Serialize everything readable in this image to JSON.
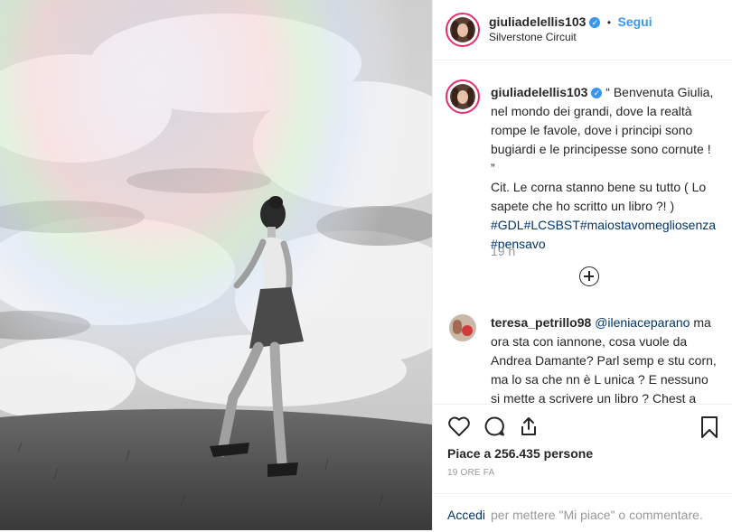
{
  "post": {
    "username": "giuliadelellis103",
    "verified_mark": "✓",
    "separator": "•",
    "follow_label": "Segui",
    "location": "Silverstone Circuit"
  },
  "caption": {
    "username": "giuliadelellis103",
    "line1": "“ Benvenuta Giulia,",
    "line2": "nel mondo dei grandi, dove la realtà",
    "line3": "rompe le favole, dove i principi sono",
    "line4": "bugiardi e le principesse sono cornute !",
    "line5": "”",
    "line6": "Cit. Le corna stanno bene su tutto ( Lo",
    "line7": "sapete che ho scritto un libro ?! )",
    "tags1": "#GDL#LCSBST#maiostavomegliosenza",
    "tags2": "#pensavo",
    "time": "19 h"
  },
  "comment": {
    "username": "teresa_petrillo98",
    "mention": "@ileniaceparano",
    "line1_rest": " ma",
    "line2": "ora sta con iannone, cosa vuole da",
    "line3": "Andrea Damante? Parl semp e stu corn,",
    "line4": "ma lo sa che nn è L unica ? E nessuno",
    "line5": "si mette a scrivere un libro ? Chest a"
  },
  "actions": {
    "like_icon": "heart-icon",
    "comment_icon": "comment-icon",
    "share_icon": "share-icon",
    "save_icon": "bookmark-icon",
    "add_comments_icon": "plus-circle-icon",
    "likes_text": "Piace a 256.435 persone",
    "date_text": "19 ORE FA"
  },
  "comment_box": {
    "login_label": "Accedi",
    "placeholder": "per mettere \"Mi piace\" o commentare."
  },
  "colors": {
    "accent": "#3897f0",
    "link": "#003569",
    "muted": "#999999",
    "story_ring": "#e1306c"
  }
}
